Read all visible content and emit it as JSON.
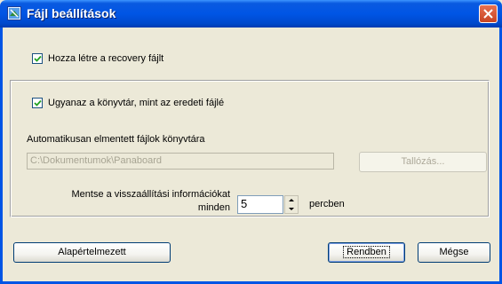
{
  "window": {
    "title": "Fájl beállítások"
  },
  "options": {
    "create_recovery": {
      "label": "Hozza létre a recovery fájlt",
      "checked": true
    },
    "same_directory": {
      "label": "Ugyanaz a könyvtár, mint az eredeti fájlé",
      "checked": true
    }
  },
  "autosave": {
    "folder_label": "Automatikusan elmentett fájlok könyvtára",
    "folder_value": "C:\\Dokumentumok\\Panaboard",
    "browse_label": "Tallózás...",
    "interval_label_line1": "Mentse a visszaállítási információkat",
    "interval_label_line2": "minden",
    "interval_value": "5",
    "interval_unit": "percben"
  },
  "buttons": {
    "default_label": "Alapértelmezett",
    "ok_label": "Rendben",
    "cancel_label": "Mégse"
  },
  "colors": {
    "title_bar": "#0055e5",
    "close_button": "#d8572e",
    "dialog_bg": "#ece9d8"
  }
}
